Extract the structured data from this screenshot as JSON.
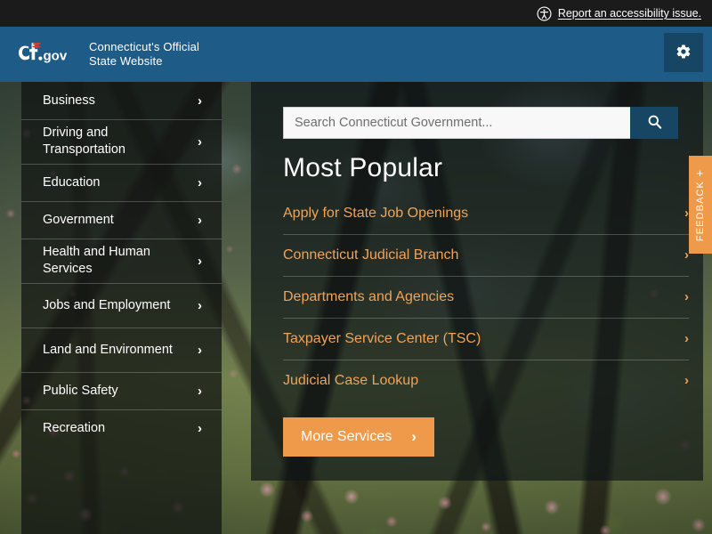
{
  "accessibility_bar": {
    "icon": "accessibility-icon",
    "link_text": "Report an accessibility issue."
  },
  "header": {
    "logo_text": "Ct.gov",
    "tagline_line1": "Connecticut's Official",
    "tagline_line2": "State Website",
    "settings_icon": "gear-icon",
    "background_color": "#1e5b86"
  },
  "sidebar": {
    "items": [
      {
        "label": "Business",
        "chevron": "›"
      },
      {
        "label": "Driving and Transportation",
        "chevron": "›"
      },
      {
        "label": "Education",
        "chevron": "›"
      },
      {
        "label": "Government",
        "chevron": "›"
      },
      {
        "label": "Health and Human Services",
        "chevron": "›"
      },
      {
        "label": "Jobs and Employment",
        "chevron": "›"
      },
      {
        "label": "Land and Environment",
        "chevron": "›"
      },
      {
        "label": "Public Safety",
        "chevron": "›"
      },
      {
        "label": "Recreation",
        "chevron": "›"
      }
    ]
  },
  "search": {
    "placeholder": "Search Connecticut Government...",
    "value": "",
    "button_icon": "search-icon",
    "button_color": "#174564"
  },
  "main": {
    "title": "Most Popular",
    "popular_links": [
      {
        "label": "Apply for State Job Openings",
        "chevron": "›"
      },
      {
        "label": "Connecticut Judicial Branch",
        "chevron": "›"
      },
      {
        "label": "Departments and Agencies",
        "chevron": "›"
      },
      {
        "label": "Taxpayer Service Center (TSC)",
        "chevron": "›"
      },
      {
        "label": "Judicial Case Lookup",
        "chevron": "›"
      }
    ],
    "link_color": "#f0a35a",
    "more_services": {
      "label": "More Services",
      "chevron": "›",
      "color": "#ef9a4b"
    }
  },
  "feedback": {
    "label": "FEEDBACK",
    "plus": "+",
    "color": "#ef9a4b"
  }
}
